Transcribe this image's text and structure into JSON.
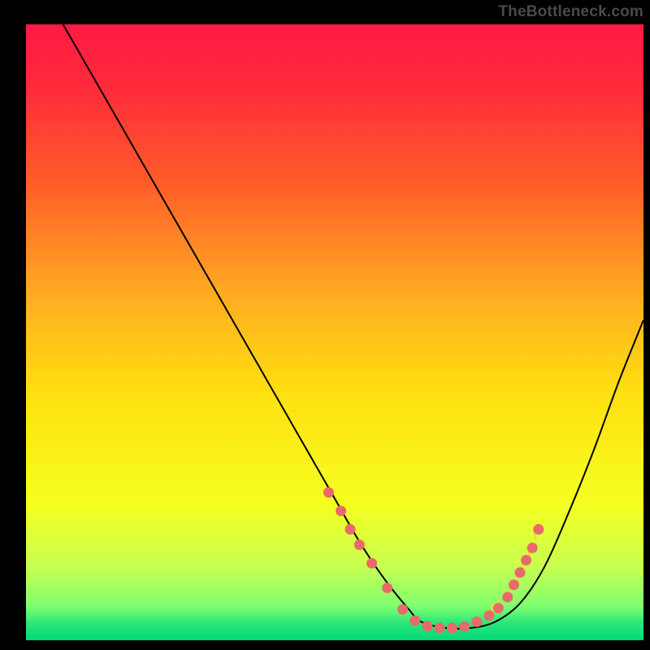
{
  "watermark": "TheBottleneck.com",
  "chart_data": {
    "type": "line",
    "title": "",
    "xlabel": "",
    "ylabel": "",
    "xlim": [
      0,
      100
    ],
    "ylim": [
      0,
      100
    ],
    "grid": false,
    "legend": false,
    "gradient_stops": [
      {
        "offset": 0.0,
        "color": "#ff1a44"
      },
      {
        "offset": 0.1,
        "color": "#ff2a3a"
      },
      {
        "offset": 0.25,
        "color": "#ff5a2a"
      },
      {
        "offset": 0.45,
        "color": "#ffb020"
      },
      {
        "offset": 0.6,
        "color": "#ffe010"
      },
      {
        "offset": 0.78,
        "color": "#f5ff20"
      },
      {
        "offset": 0.88,
        "color": "#c8ff50"
      },
      {
        "offset": 0.945,
        "color": "#80ff70"
      },
      {
        "offset": 0.97,
        "color": "#30e878"
      },
      {
        "offset": 1.0,
        "color": "#00d878"
      }
    ],
    "series": [
      {
        "name": "bottleneck-curve",
        "x": [
          6,
          10,
          14,
          18,
          22,
          26,
          30,
          34,
          38,
          42,
          46,
          50,
          54,
          58,
          62,
          64,
          68,
          72,
          76,
          80,
          84,
          88,
          92,
          96,
          100
        ],
        "y": [
          100,
          93,
          86,
          79,
          72,
          65,
          58,
          51,
          44,
          37,
          30,
          23,
          16,
          10,
          5,
          3,
          2,
          2,
          3,
          6,
          12,
          21,
          31,
          42,
          52
        ],
        "color": "#000000",
        "width": 2
      }
    ],
    "markers": {
      "name": "highlight-points",
      "color": "#e96a6a",
      "radius": 6.5,
      "points": [
        {
          "x": 49,
          "y": 24
        },
        {
          "x": 51,
          "y": 21
        },
        {
          "x": 52.5,
          "y": 18
        },
        {
          "x": 54,
          "y": 15.5
        },
        {
          "x": 56,
          "y": 12.5
        },
        {
          "x": 58.5,
          "y": 8.5
        },
        {
          "x": 61,
          "y": 5
        },
        {
          "x": 63,
          "y": 3.2
        },
        {
          "x": 65,
          "y": 2.3
        },
        {
          "x": 67,
          "y": 2
        },
        {
          "x": 69,
          "y": 2
        },
        {
          "x": 71,
          "y": 2.2
        },
        {
          "x": 73,
          "y": 3
        },
        {
          "x": 75,
          "y": 4
        },
        {
          "x": 76.5,
          "y": 5.2
        },
        {
          "x": 78,
          "y": 7
        },
        {
          "x": 79,
          "y": 9
        },
        {
          "x": 80,
          "y": 11
        },
        {
          "x": 81,
          "y": 13
        },
        {
          "x": 82,
          "y": 15
        },
        {
          "x": 83,
          "y": 18
        }
      ]
    },
    "ticks": {
      "name": "yellow-ticks",
      "color": "#f5d840",
      "points": [
        {
          "x": 75.5,
          "y": 4.5
        },
        {
          "x": 76.5,
          "y": 5.5
        },
        {
          "x": 77.5,
          "y": 6.8
        },
        {
          "x": 78.5,
          "y": 8.2
        },
        {
          "x": 79.5,
          "y": 10
        },
        {
          "x": 80.5,
          "y": 12
        },
        {
          "x": 81.5,
          "y": 14
        },
        {
          "x": 82.5,
          "y": 16.5
        }
      ]
    }
  }
}
